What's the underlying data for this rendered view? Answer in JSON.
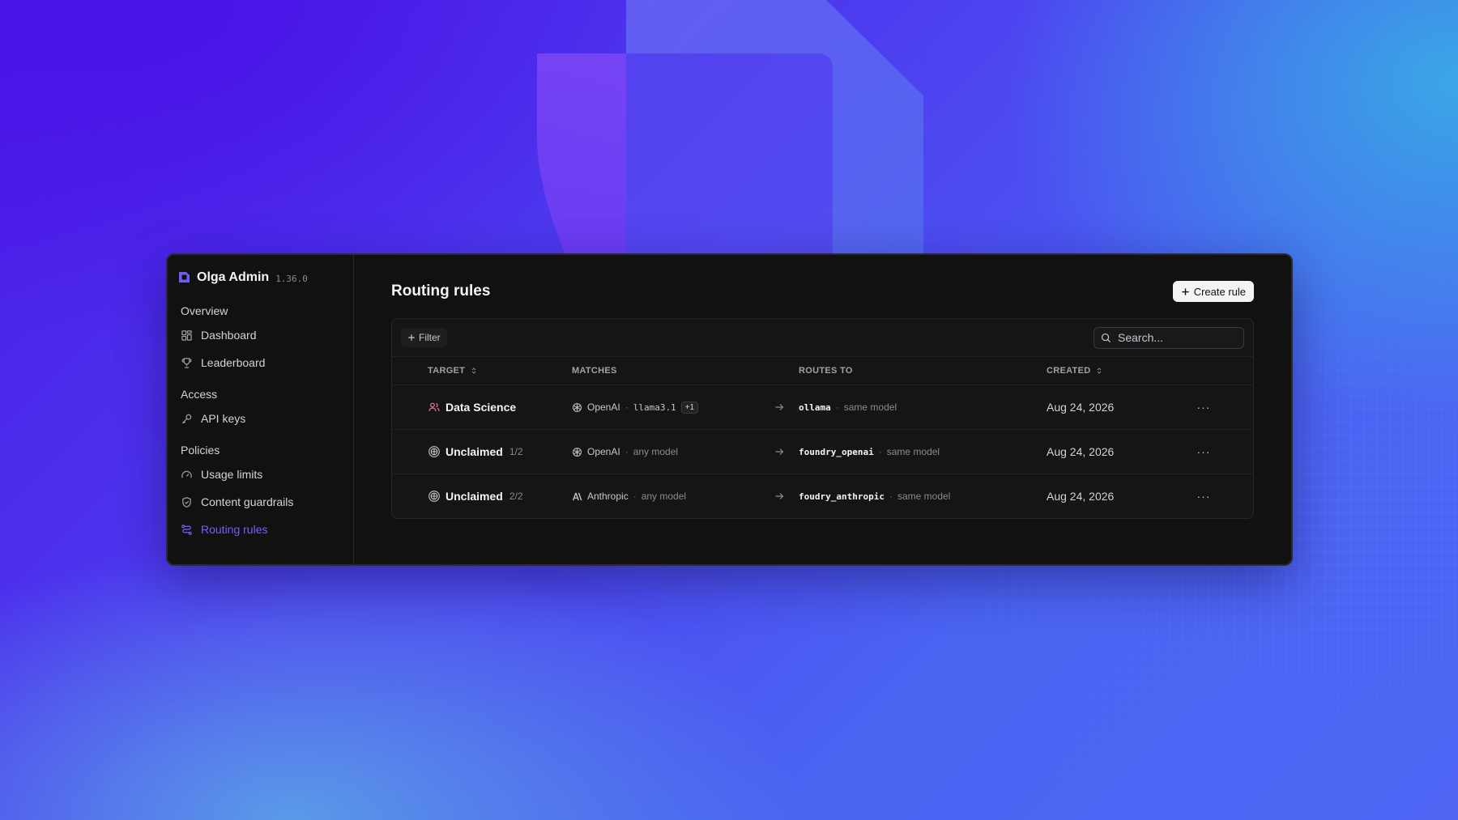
{
  "app": {
    "name": "Olga Admin",
    "version": "1.36.0"
  },
  "sidebar": {
    "sections": [
      {
        "label": "Overview",
        "items": [
          {
            "label": "Dashboard",
            "icon": "dashboard-icon",
            "active": false
          },
          {
            "label": "Leaderboard",
            "icon": "trophy-icon",
            "active": false
          }
        ]
      },
      {
        "label": "Access",
        "items": [
          {
            "label": "API keys",
            "icon": "key-icon",
            "active": false
          }
        ]
      },
      {
        "label": "Policies",
        "items": [
          {
            "label": "Usage limits",
            "icon": "gauge-icon",
            "active": false
          },
          {
            "label": "Content guardrails",
            "icon": "shield-check-icon",
            "active": false
          },
          {
            "label": "Routing rules",
            "icon": "route-icon",
            "active": true
          }
        ]
      }
    ]
  },
  "page": {
    "title": "Routing rules",
    "create_label": "Create rule"
  },
  "toolbar": {
    "filter_label": "Filter",
    "search_placeholder": "Search..."
  },
  "table": {
    "headers": {
      "target": "TARGET",
      "matches": "MATCHES",
      "routes_to": "ROUTES TO",
      "created": "CREATED"
    },
    "rows": [
      {
        "target": "Data Science",
        "target_icon": "users-icon",
        "target_count": "",
        "provider": "OpenAI",
        "provider_icon": "openai-icon",
        "model": "llama3.1",
        "extra": "+1",
        "route": "ollama",
        "route_model": "same model",
        "created": "Aug 24, 2026"
      },
      {
        "target": "Unclaimed",
        "target_icon": "globe-icon",
        "target_count": "1/2",
        "provider": "OpenAI",
        "provider_icon": "openai-icon",
        "model": "any model",
        "extra": "",
        "route": "foundry_openai",
        "route_model": "same model",
        "created": "Aug 24, 2026"
      },
      {
        "target": "Unclaimed",
        "target_icon": "globe-icon",
        "target_count": "2/2",
        "provider": "Anthropic",
        "provider_icon": "anthropic-icon",
        "model": "any model",
        "extra": "",
        "route": "foudry_anthropic",
        "route_model": "same model",
        "created": "Aug 24, 2026"
      }
    ]
  },
  "colors": {
    "accent": "#7c5cff",
    "window_bg": "#111112",
    "text": "#f4f4f5",
    "muted": "#8a8a90"
  }
}
